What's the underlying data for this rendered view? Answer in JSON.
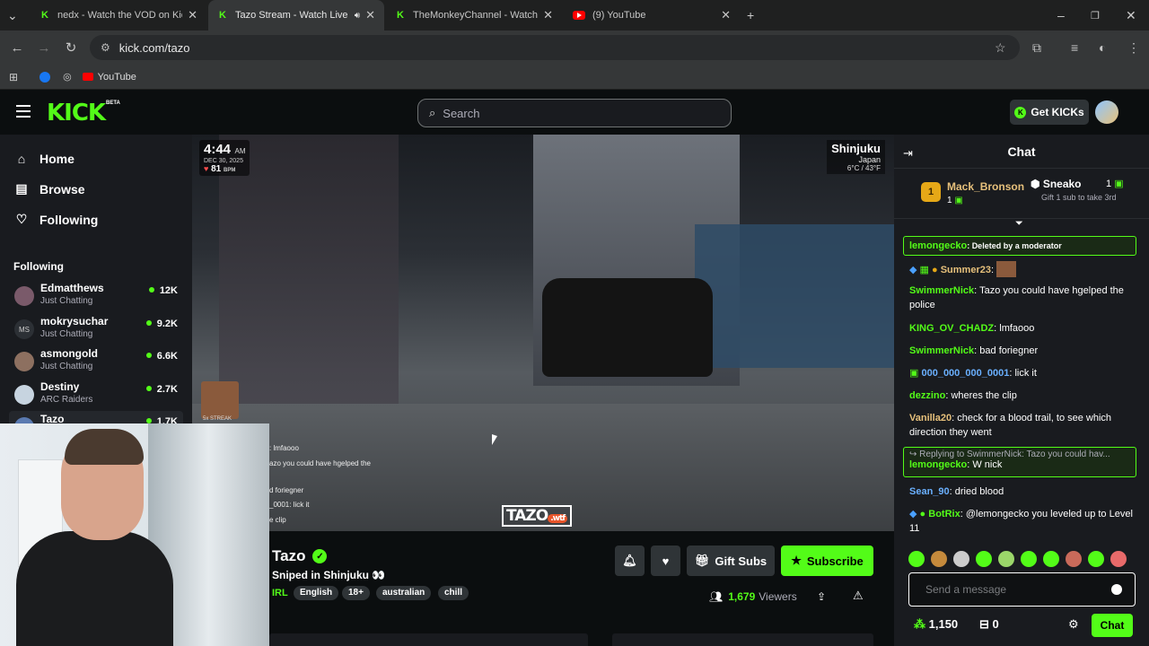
{
  "browser": {
    "tabs": [
      {
        "title": "nedx - Watch the VOD on Kick",
        "favicon": "kick"
      },
      {
        "title": "Tazo Stream - Watch Live on",
        "favicon": "kick",
        "active": true
      },
      {
        "title": "TheMonkeyChannel - Watch the",
        "favicon": "kick"
      },
      {
        "title": "(9) YouTube",
        "favicon": "youtube"
      }
    ],
    "url": "kick.com/tazo",
    "bookmarks": [
      {
        "label": "YouTube"
      }
    ]
  },
  "header": {
    "logo": "KICK",
    "beta": "BETA",
    "search_placeholder": "Search",
    "get_kicks": "Get KICKs"
  },
  "sidebar": {
    "nav": [
      {
        "label": "Home",
        "icon": "home-icon"
      },
      {
        "label": "Browse",
        "icon": "browse-icon"
      },
      {
        "label": "Following",
        "icon": "heart-icon"
      }
    ],
    "following_title": "Following",
    "channels": [
      {
        "name": "Edmatthews",
        "sub": "Just Chatting",
        "viewers": "12K"
      },
      {
        "name": "mokrysuchar",
        "sub": "Just Chatting",
        "viewers": "9.2K"
      },
      {
        "name": "asmongold",
        "sub": "Just Chatting",
        "viewers": "6.6K"
      },
      {
        "name": "Destiny",
        "sub": "ARC Raiders",
        "viewers": "2.7K"
      },
      {
        "name": "Tazo",
        "sub": "",
        "viewers": "1.7K"
      }
    ]
  },
  "video": {
    "time": "4:44",
    "ampm": "AM",
    "date": "DEC 30, 2025",
    "bpm": "81",
    "bpm_unit": "BPM",
    "city": "Shinjuku",
    "country": "Japan",
    "weather": "6°C / 43°F",
    "streak": "5x STREAK",
    "overlay_chat": [
      ": lmfaooo",
      "azo you could have hgelped the",
      "d foriegner",
      "_0001: lick it",
      "e clip"
    ],
    "watermark": "TAZO",
    "watermark_sub": ".wtf"
  },
  "stream": {
    "channel": "Tazo",
    "title": "Sniped in Shinjuku",
    "category": "IRL",
    "tags": [
      "English",
      "18+",
      "australian",
      "chill"
    ],
    "gift_subs": "Gift Subs",
    "subscribe": "Subscribe",
    "viewers": "1,679",
    "viewers_label": "Viewers"
  },
  "chat": {
    "title": "Chat",
    "pinned": {
      "rank": "1",
      "user1": "Mack_Bronson",
      "user1_count": "1",
      "user2": "Sneako",
      "user2_count": "1",
      "gift_text": "Gift 1 sub to take 3rd"
    },
    "messages": [
      {
        "user": "lemongecko",
        "text": "Deleted by a moderator",
        "color": "#53fc18"
      },
      {
        "user": "Summer23",
        "text": "",
        "color": "#e6c07b"
      },
      {
        "user": "SwimmerNick",
        "text": "Tazo you could have hgelped the police",
        "color": "#53fc18"
      },
      {
        "user": "KING_OV_CHADZ",
        "text": "lmfaooo",
        "color": "#53fc18"
      },
      {
        "user": "SwimmerNick",
        "text": "bad foriegner",
        "color": "#53fc18"
      },
      {
        "user": "000_000_000_0001",
        "text": "lick it",
        "color": "#6ab0ff"
      },
      {
        "user": "dezzino",
        "text": "wheres the clip",
        "color": "#53fc18"
      },
      {
        "user": "Vanilla20",
        "text": "check for a blood trail, to see which direction they went",
        "color": "#e6c07b"
      },
      {
        "user": "Sean_90",
        "text": "dried blood",
        "color": "#6ab0ff"
      },
      {
        "user": "BotRix",
        "text": "@lemongecko you leveled up to Level 11",
        "color": "#53fc18"
      }
    ],
    "reply": {
      "replying": "Replying to SwimmerNick: Tazo you could hav...",
      "user": "lemongecko",
      "text": "W nick"
    },
    "input_placeholder": "Send a message",
    "kicks": "1,150",
    "points": "0",
    "send": "Chat"
  }
}
